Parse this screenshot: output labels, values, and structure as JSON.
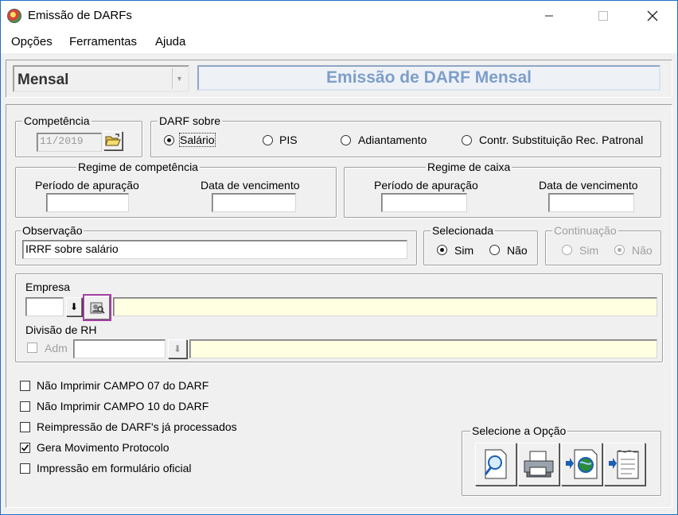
{
  "window": {
    "title": "Emissão de DARFs"
  },
  "menu": [
    "Opções",
    "Ferramentas",
    "Ajuda"
  ],
  "header": {
    "period_type": "Mensal",
    "banner": "Emissão de DARF Mensal"
  },
  "competencia": {
    "legend": "Competência",
    "value": "11/2019"
  },
  "darf_sobre": {
    "legend": "DARF sobre",
    "options": [
      "Salário",
      "PIS",
      "Adiantamento",
      "Contr. Substituição Rec. Patronal"
    ],
    "selected": "Salário"
  },
  "regime_competencia": {
    "legend": "Regime de competência",
    "periodo_label": "Período de apuração",
    "periodo_value": "",
    "vencimento_label": "Data de vencimento",
    "vencimento_value": ""
  },
  "regime_caixa": {
    "legend": "Regime de caixa",
    "periodo_label": "Período de apuração",
    "periodo_value": "",
    "vencimento_label": "Data de vencimento",
    "vencimento_value": ""
  },
  "observacao": {
    "legend": "Observação",
    "value": "IRRF sobre salário"
  },
  "selecionada": {
    "legend": "Selecionada",
    "sim": "Sim",
    "nao": "Não",
    "selected": "Sim"
  },
  "continuacao": {
    "legend": "Continuação",
    "sim": "Sim",
    "nao": "Não",
    "selected": "Não",
    "enabled": false
  },
  "empresa": {
    "label": "Empresa",
    "code": "",
    "name": ""
  },
  "divisao": {
    "label": "Divisão de RH",
    "adm_label": "Adm",
    "code": "",
    "name": ""
  },
  "checkboxes": [
    {
      "label": "Não Imprimir CAMPO 07 do DARF",
      "checked": false
    },
    {
      "label": "Não Imprimir CAMPO 10 do DARF",
      "checked": false
    },
    {
      "label": "Reimpressão de DARF's já processados",
      "checked": false
    },
    {
      "label": "Gera Movimento Protocolo",
      "checked": true
    },
    {
      "label": "Impressão em formulário oficial",
      "checked": false
    }
  ],
  "selecione": {
    "legend": "Selecione a Opção",
    "buttons": [
      "preview-icon",
      "printer-icon",
      "export-web-icon",
      "export-file-icon"
    ]
  },
  "colors": {
    "banner_text": "#7d9ec9",
    "highlight_border": "#a13ea1",
    "input_yellow": "#ffffe1"
  }
}
